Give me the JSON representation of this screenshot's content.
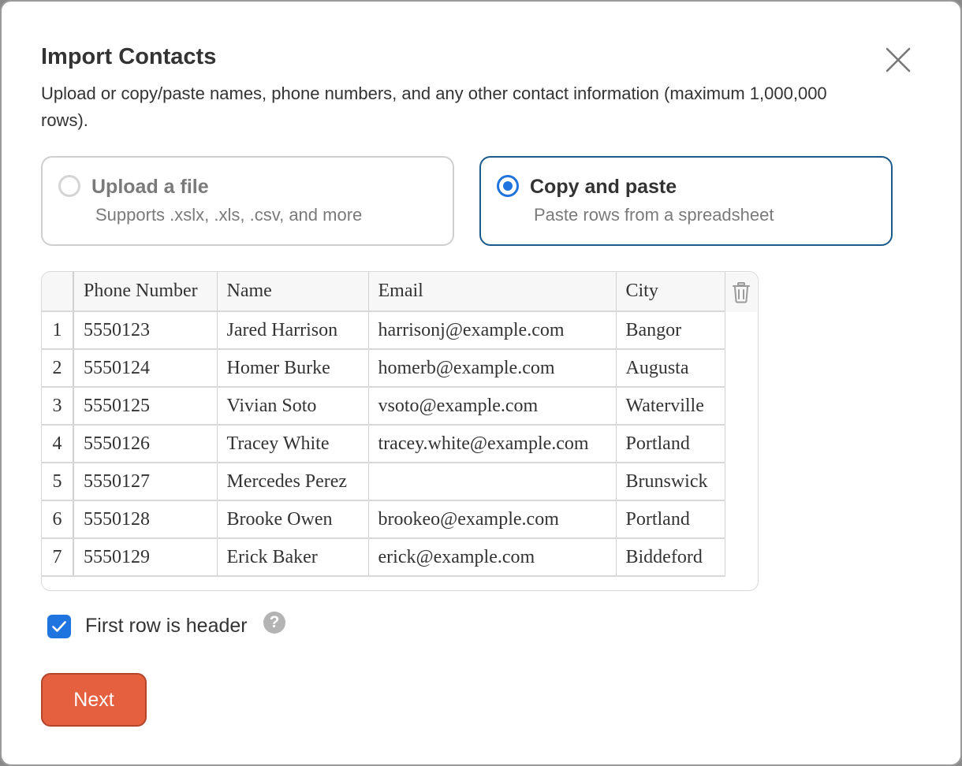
{
  "dialog": {
    "title": "Import Contacts",
    "description": "Upload or copy/paste names, phone numbers, and any other contact information (maximum 1,000,000 rows)."
  },
  "options": {
    "upload": {
      "title": "Upload a file",
      "description": "Supports .xslx, .xls, .csv, and more",
      "selected": false
    },
    "paste": {
      "title": "Copy and paste",
      "description": "Paste rows from a spreadsheet",
      "selected": true
    }
  },
  "grid": {
    "columns": [
      "Phone Number",
      "Name",
      "Email",
      "City"
    ],
    "rows": [
      {
        "index": "1",
        "phone": "5550123",
        "name": "Jared Harrison",
        "email": "harrisonj@example.com",
        "city": "Bangor"
      },
      {
        "index": "2",
        "phone": "5550124",
        "name": "Homer Burke",
        "email": "homerb@example.com",
        "city": "Augusta"
      },
      {
        "index": "3",
        "phone": "5550125",
        "name": "Vivian Soto",
        "email": "vsoto@example.com",
        "city": "Waterville"
      },
      {
        "index": "4",
        "phone": "5550126",
        "name": "Tracey White",
        "email": "tracey.white@example.com",
        "city": "Portland"
      },
      {
        "index": "5",
        "phone": "5550127",
        "name": "Mercedes Perez",
        "email": "",
        "city": "Brunswick"
      },
      {
        "index": "6",
        "phone": "5550128",
        "name": "Brooke Owen",
        "email": "brookeo@example.com",
        "city": "Portland"
      },
      {
        "index": "7",
        "phone": "5550129",
        "name": "Erick Baker",
        "email": "erick@example.com",
        "city": "Biddeford"
      }
    ]
  },
  "first_row_header": {
    "label": "First row is header",
    "checked": true,
    "help_glyph": "?"
  },
  "actions": {
    "next_label": "Next"
  },
  "colors": {
    "accent": "#1f74e0",
    "primary_button": "#e5603f",
    "selected_border": "#1a5a8a"
  },
  "icons": {
    "close": "close-icon",
    "trash": "trash-icon",
    "help": "help-icon",
    "check": "check-icon"
  }
}
